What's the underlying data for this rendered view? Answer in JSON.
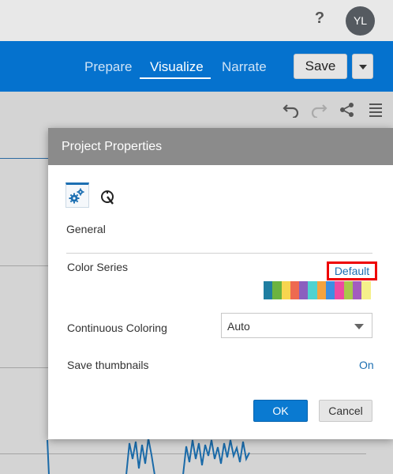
{
  "topbar": {
    "help_icon": "?",
    "avatar_initials": "YL"
  },
  "nav": {
    "tabs": [
      {
        "label": "Prepare",
        "active": false
      },
      {
        "label": "Visualize",
        "active": true
      },
      {
        "label": "Narrate",
        "active": false
      }
    ],
    "save_label": "Save"
  },
  "toolbar": {
    "icons": [
      "undo-icon",
      "redo-icon",
      "share-icon",
      "menu-icon"
    ]
  },
  "dialog": {
    "title": "Project Properties",
    "tabs": [
      {
        "icon": "gears-icon",
        "active": true
      },
      {
        "icon": "performance-icon",
        "active": false
      }
    ],
    "section_label": "General",
    "color_series": {
      "label": "Color Series",
      "value_link": "Default",
      "palette": [
        "#1f7ea1",
        "#6cb33f",
        "#f7d54f",
        "#ee6a50",
        "#8b5fbf",
        "#4fd2d0",
        "#f5a340",
        "#3c8ee2",
        "#ee4aa1",
        "#a8c94b",
        "#a35cbf",
        "#f5f08a"
      ]
    },
    "continuous_coloring": {
      "label": "Continuous Coloring",
      "value": "Auto"
    },
    "save_thumbnails": {
      "label": "Save thumbnails",
      "value": "On"
    },
    "ok_label": "OK",
    "cancel_label": "Cancel"
  },
  "colors": {
    "brand_blue": "#0572ce",
    "highlight_red": "#ee0000"
  }
}
